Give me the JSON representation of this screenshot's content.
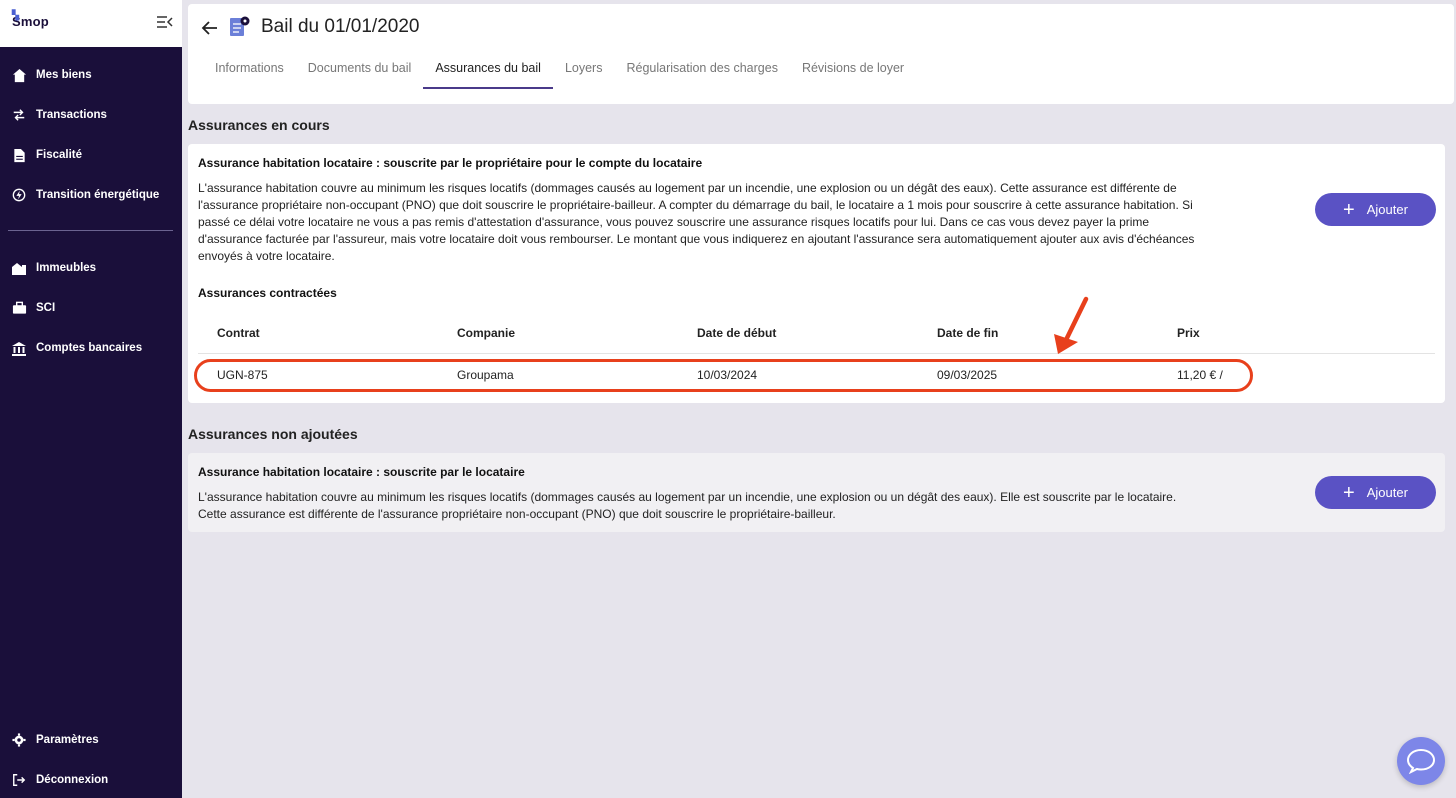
{
  "app": {
    "logo_text": "Smop"
  },
  "sidebar": {
    "items": [
      {
        "label": "Mes biens",
        "icon": "home-icon"
      },
      {
        "label": "Transactions",
        "icon": "swap-icon"
      },
      {
        "label": "Fiscalité",
        "icon": "document-icon"
      },
      {
        "label": "Transition énergétique",
        "icon": "energy-icon"
      },
      {
        "label": "Immeubles",
        "icon": "buildings-icon"
      },
      {
        "label": "SCI",
        "icon": "briefcase-icon"
      },
      {
        "label": "Comptes bancaires",
        "icon": "bank-icon"
      }
    ],
    "bottom_items": [
      {
        "label": "Paramètres",
        "icon": "gear-icon"
      },
      {
        "label": "Déconnexion",
        "icon": "logout-icon"
      }
    ]
  },
  "header": {
    "title": "Bail du 01/01/2020",
    "tabs": [
      {
        "label": "Informations",
        "active": false
      },
      {
        "label": "Documents du bail",
        "active": false
      },
      {
        "label": "Assurances du bail",
        "active": true
      },
      {
        "label": "Loyers",
        "active": false
      },
      {
        "label": "Régularisation des charges",
        "active": false
      },
      {
        "label": "Révisions de loyer",
        "active": false
      }
    ]
  },
  "current": {
    "section_title": "Assurances en cours",
    "card_heading": "Assurance habitation locataire : souscrite par le propriétaire pour le compte du locataire",
    "description_lines": [
      "L'assurance habitation couvre au minimum les risques locatifs (dommages causés au logement par un incendie, une explosion ou un dégât des eaux). Cette assurance est différente de",
      "l'assurance propriétaire non-occupant (PNO) que doit souscrire le propriétaire-bailleur. A compter du démarrage du bail, le locataire a 1 mois pour souscrire à cette assurance habitation. Si",
      "passé ce délai votre locataire ne vous a pas remis d'attestation d'assurance, vous pouvez souscrire une assurance risques locatifs pour lui. Dans ce cas vous devez payer la prime",
      "d'assurance facturée par l'assureur, mais votre locataire doit vous rembourser. Le montant que vous indiquerez en ajoutant l'assurance sera automatiquement ajouter aux avis d'échéances",
      "envoyés à votre locataire."
    ],
    "add_label": "Ajouter",
    "contracts_heading": "Assurances contractées",
    "columns": [
      "Contrat",
      "Companie",
      "Date de début",
      "Date de fin",
      "Prix"
    ],
    "rows": [
      {
        "contrat": "UGN-875",
        "companie": "Groupama",
        "debut": "10/03/2024",
        "fin": "09/03/2025",
        "prix": "11,20 € /"
      }
    ]
  },
  "not_added": {
    "section_title": "Assurances non ajoutées",
    "card_heading": "Assurance habitation locataire : souscrite par le locataire",
    "description_lines": [
      "L'assurance habitation couvre au minimum les risques locatifs (dommages causés au logement par un incendie, une explosion ou un dégât des eaux). Elle est souscrite par le locataire.",
      "Cette assurance est différente de l'assurance propriétaire non-occupant (PNO) que doit souscrire le propriétaire-bailleur."
    ],
    "add_label": "Ajouter"
  },
  "colors": {
    "sidebar_bg": "#1a0f3a",
    "accent": "#5a52c4",
    "highlight": "#e8401c",
    "chat": "#7d86e8"
  }
}
